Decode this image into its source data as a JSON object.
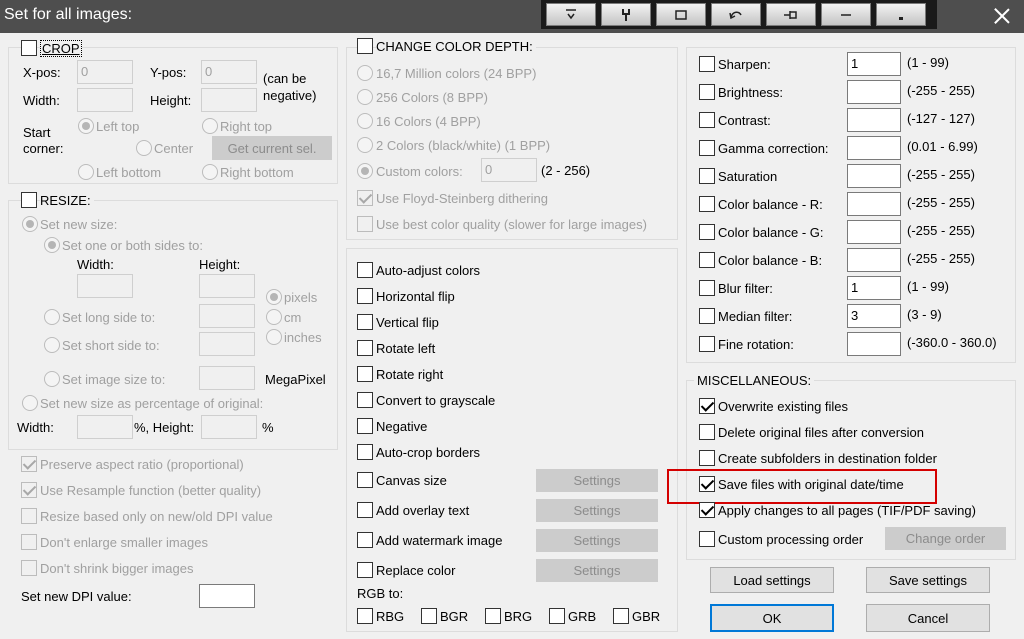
{
  "window": {
    "title": "Set for all images:"
  },
  "crop": {
    "label": "CROP",
    "xpos_label": "X-pos:",
    "xpos_value": "0",
    "ypos_label": "Y-pos:",
    "ypos_value": "0",
    "can_be_1": "(can be",
    "can_be_2": "negative)",
    "width_label": "Width:",
    "height_label": "Height:",
    "start_corner_1": "Start",
    "start_corner_2": "corner:",
    "left_top": "Left top",
    "right_top": "Right top",
    "center": "Center",
    "left_bottom": "Left bottom",
    "right_bottom": "Right bottom",
    "get_current_sel": "Get current sel."
  },
  "resize": {
    "label": "RESIZE:",
    "set_new_size": "Set new size:",
    "set_one_or_both": "Set one or both sides to:",
    "width_label": "Width:",
    "height_label": "Height:",
    "pixels": "pixels",
    "cm": "cm",
    "inches": "inches",
    "long_side": "Set long side to:",
    "short_side": "Set short side to:",
    "image_size": "Set image size to:",
    "megapixel": "MegaPixel",
    "percentage": "Set new size as percentage of original:",
    "pct_width": "Width:",
    "pct_height": "%, Height:",
    "pct_sign": "%",
    "preserve_aspect": "Preserve aspect ratio (proportional)",
    "use_resample": "Use Resample function (better quality)",
    "resize_dpi": "Resize based only on new/old DPI value",
    "dont_enlarge": "Don't enlarge smaller images",
    "dont_shrink": "Don't shrink bigger images",
    "set_dpi": "Set new DPI value:"
  },
  "color_depth": {
    "label": "CHANGE COLOR DEPTH:",
    "opt_24": "16,7 Million colors (24 BPP)",
    "opt_8": "256 Colors (8 BPP)",
    "opt_4": "16 Colors (4 BPP)",
    "opt_1": "2 Colors (black/white) (1 BPP)",
    "custom": "Custom colors:",
    "custom_value": "0",
    "custom_range": "(2 - 256)",
    "floyd": "Use Floyd-Steinberg dithering",
    "best_quality": "Use best color quality (slower for large images)"
  },
  "transforms": {
    "auto_adjust": "Auto-adjust colors",
    "hflip": "Horizontal flip",
    "vflip": "Vertical flip",
    "rot_left": "Rotate left",
    "rot_right": "Rotate right",
    "grayscale": "Convert to grayscale",
    "negative": "Negative",
    "autocrop": "Auto-crop borders",
    "canvas": "Canvas size",
    "overlay": "Add overlay text",
    "watermark": "Add watermark image",
    "replace_color": "Replace color",
    "settings": "Settings",
    "rgb_to": "RGB to:",
    "rgb_opts": [
      "RBG",
      "BGR",
      "BRG",
      "GRB",
      "GBR"
    ]
  },
  "filters": [
    {
      "label": "Sharpen:",
      "value": "1",
      "range": "(1  -  99)"
    },
    {
      "label": "Brightness:",
      "value": "",
      "range": "(-255  -  255)"
    },
    {
      "label": "Contrast:",
      "value": "",
      "range": "(-127  -  127)"
    },
    {
      "label": "Gamma correction:",
      "value": "",
      "range": "(0.01  -  6.99)"
    },
    {
      "label": "Saturation",
      "value": "",
      "range": "(-255  -  255)"
    },
    {
      "label": "Color balance - R:",
      "value": "",
      "range": "(-255  -  255)"
    },
    {
      "label": "Color balance - G:",
      "value": "",
      "range": "(-255  -  255)"
    },
    {
      "label": "Color balance - B:",
      "value": "",
      "range": "(-255  -  255)"
    },
    {
      "label": "Blur filter:",
      "value": "1",
      "range": "(1  -  99)"
    },
    {
      "label": "Median filter:",
      "value": "3",
      "range": "(3  -  9)"
    },
    {
      "label": "Fine rotation:",
      "value": "",
      "range": "(-360.0  -  360.0)"
    }
  ],
  "misc": {
    "label": "MISCELLANEOUS:",
    "overwrite": "Overwrite existing files",
    "delete_orig": "Delete original files after conversion",
    "subfolders": "Create subfolders in destination folder",
    "save_date": "Save files with original date/time",
    "apply_pages": "Apply changes to all pages (TIF/PDF saving)",
    "custom_order": "Custom processing order",
    "change_order": "Change order"
  },
  "buttons": {
    "load": "Load settings",
    "save": "Save settings",
    "ok": "OK",
    "cancel": "Cancel"
  },
  "colors": {
    "titlebar": "#4e4e4e",
    "highlight": "#d40000",
    "ok_border": "#0078d7"
  }
}
